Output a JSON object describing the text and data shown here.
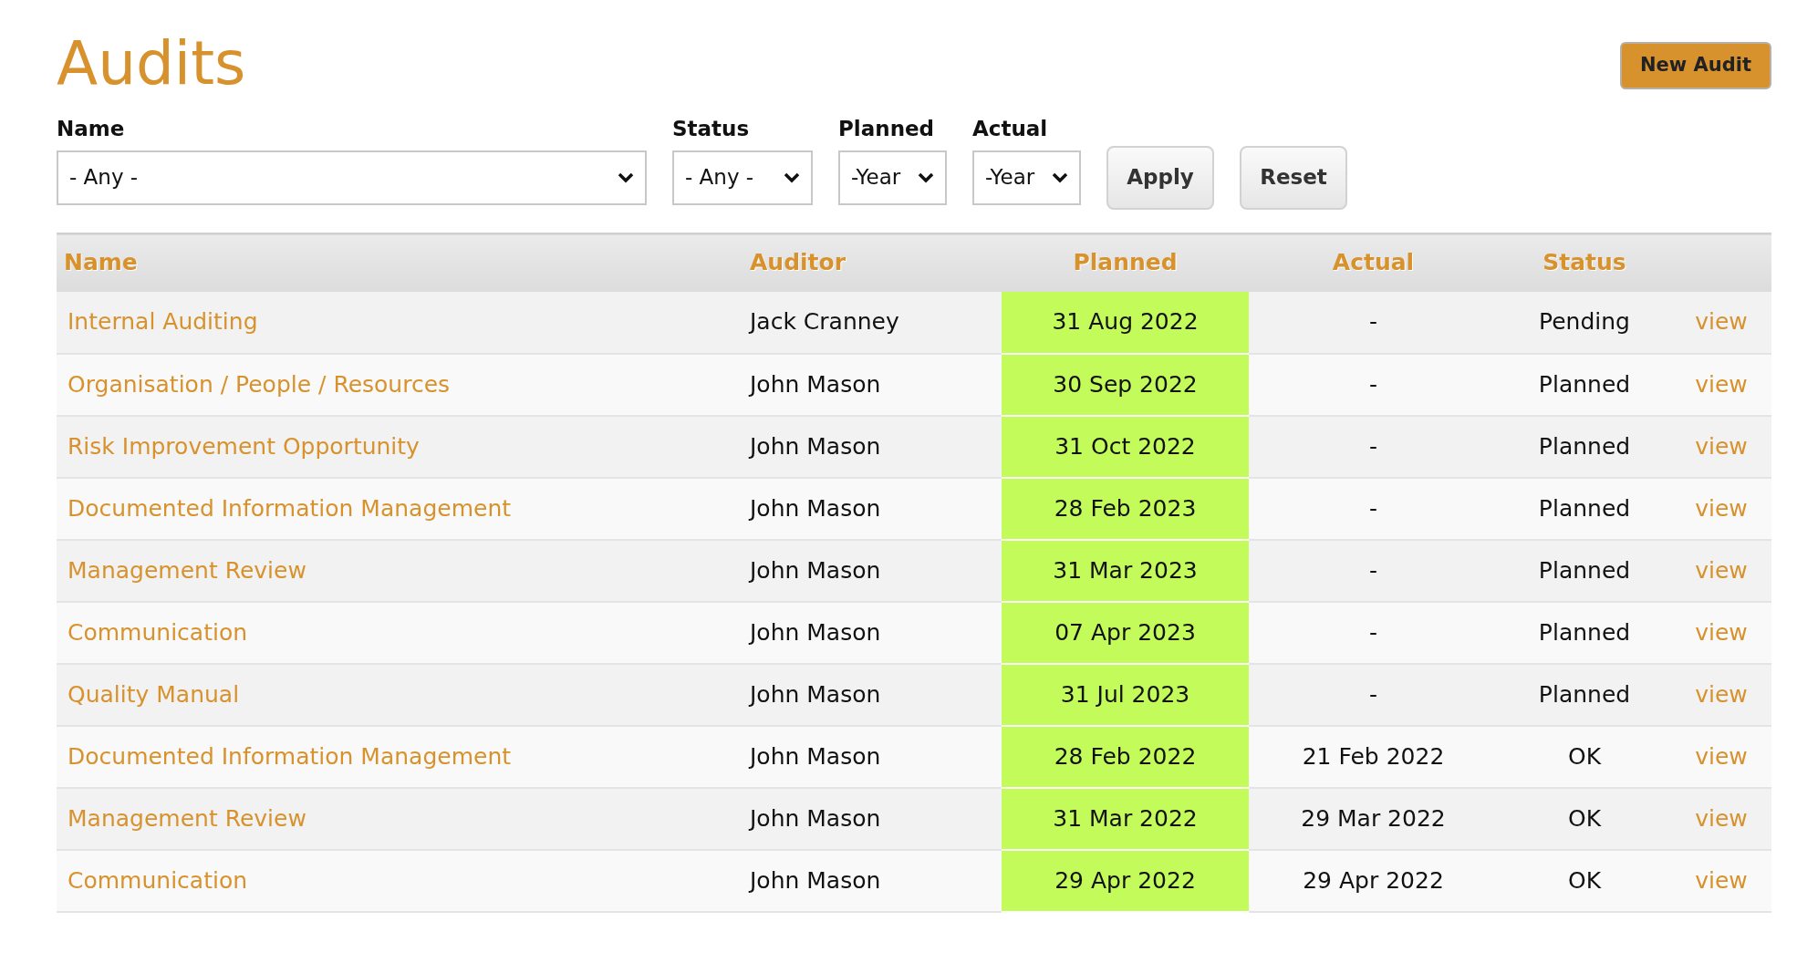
{
  "title": "Audits",
  "new_button": "New Audit",
  "filters": [
    {
      "label": "Name",
      "value": "- Any -",
      "kind": "wide"
    },
    {
      "label": "Status",
      "value": "- Any -",
      "kind": "medium"
    },
    {
      "label": "Planned",
      "value": "-Year",
      "kind": "narrow"
    },
    {
      "label": "Actual",
      "value": "-Year",
      "kind": "narrow"
    }
  ],
  "filter_buttons": [
    "Apply",
    "Reset"
  ],
  "table": {
    "columns": [
      "Name",
      "Auditor",
      "Planned",
      "Actual",
      "Status"
    ],
    "rows": [
      {
        "name": "Internal Auditing",
        "auditor": "Jack Cranney",
        "planned": "31 Aug 2022",
        "actual": "-",
        "status": "Pending",
        "action": "view"
      },
      {
        "name": "Organisation / People / Resources",
        "auditor": "John Mason",
        "planned": "30 Sep 2022",
        "actual": "-",
        "status": "Planned",
        "action": "view"
      },
      {
        "name": "Risk Improvement Opportunity",
        "auditor": "John Mason",
        "planned": "31 Oct 2022",
        "actual": "-",
        "status": "Planned",
        "action": "view"
      },
      {
        "name": "Documented Information Management",
        "auditor": "John Mason",
        "planned": "28 Feb 2023",
        "actual": "-",
        "status": "Planned",
        "action": "view"
      },
      {
        "name": "Management Review",
        "auditor": "John Mason",
        "planned": "31 Mar 2023",
        "actual": "-",
        "status": "Planned",
        "action": "view"
      },
      {
        "name": "Communication",
        "auditor": "John Mason",
        "planned": "07 Apr 2023",
        "actual": "-",
        "status": "Planned",
        "action": "view"
      },
      {
        "name": "Quality Manual",
        "auditor": "John Mason",
        "planned": "31 Jul 2023",
        "actual": "-",
        "status": "Planned",
        "action": "view"
      },
      {
        "name": "Documented Information Management",
        "auditor": "John Mason",
        "planned": "28 Feb 2022",
        "actual": "21 Feb 2022",
        "status": "OK",
        "action": "view"
      },
      {
        "name": "Management Review",
        "auditor": "John Mason",
        "planned": "31 Mar 2022",
        "actual": "29 Mar 2022",
        "status": "OK",
        "action": "view"
      },
      {
        "name": "Communication",
        "auditor": "John Mason",
        "planned": "29 Apr 2022",
        "actual": "29 Apr 2022",
        "status": "OK",
        "action": "view"
      }
    ]
  }
}
